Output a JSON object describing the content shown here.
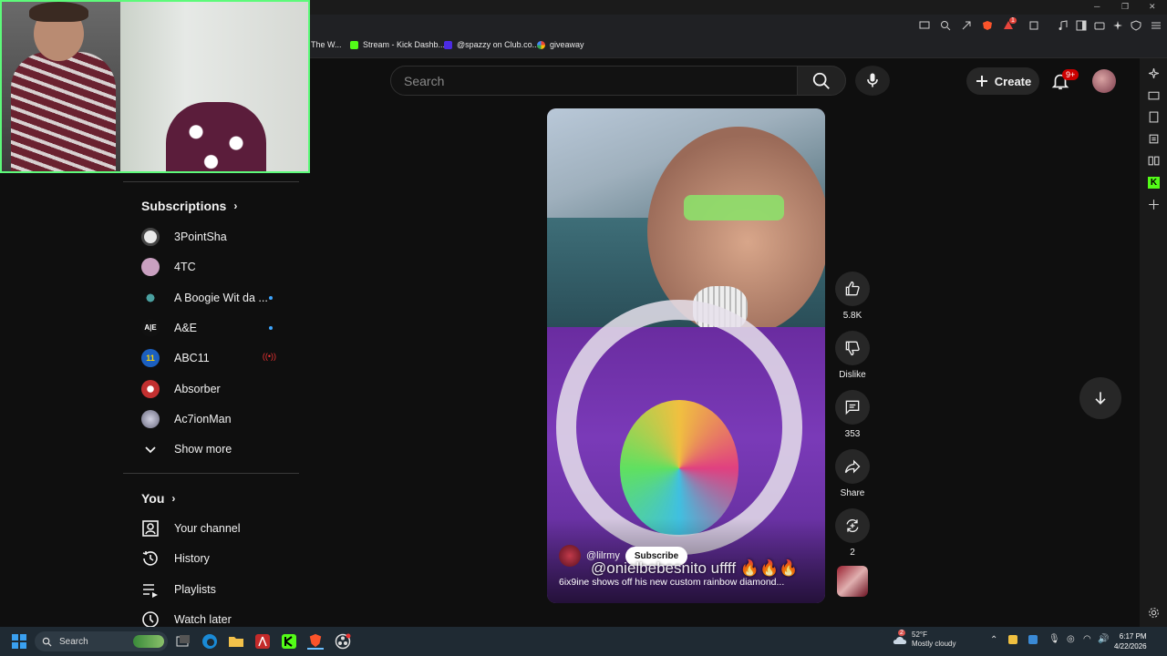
{
  "browser": {
    "bookmarks": [
      {
        "label": "The W...",
        "color": "#888888"
      },
      {
        "label": "Stream - Kick Dashb...",
        "color": "#53fc18"
      },
      {
        "label": "@spazzy on Club.co...",
        "color": "#4b2be3"
      },
      {
        "label": "giveaway",
        "color": "#e8a33d"
      }
    ],
    "shield_badge": "1"
  },
  "header": {
    "search_placeholder": "Search",
    "create_label": "Create",
    "notifications_badge": "9+"
  },
  "sidebar": {
    "subscriptions_heading": "Subscriptions",
    "subscriptions": [
      {
        "name": "3PointSha",
        "avatar_color": "#e8e8e8",
        "indicator": "none"
      },
      {
        "name": "4TC",
        "avatar_color": "#c9a0c0",
        "indicator": "none"
      },
      {
        "name": "A Boogie Wit da ...",
        "avatar_color": "#4aa0a0",
        "indicator": "new"
      },
      {
        "name": "A&E",
        "avatar_color": "#111111",
        "indicator": "new"
      },
      {
        "name": "ABC11",
        "avatar_color": "#1b5fbf",
        "indicator": "live"
      },
      {
        "name": "Absorber",
        "avatar_color": "#c23030",
        "indicator": "none"
      },
      {
        "name": "Ac7ionMan",
        "avatar_color": "#b0b0c0",
        "indicator": "none"
      }
    ],
    "show_more_label": "Show more",
    "you_heading": "You",
    "you_items": [
      {
        "label": "Your channel",
        "icon": "person-box-icon"
      },
      {
        "label": "History",
        "icon": "history-icon"
      },
      {
        "label": "Playlists",
        "icon": "playlists-icon"
      },
      {
        "label": "Watch later",
        "icon": "clock-icon"
      }
    ]
  },
  "short": {
    "channel_handle": "@lilrmy",
    "subscribe_label": "Subscribe",
    "overlay_caption": "@onielbebesnito uffff 🔥🔥🔥",
    "title": "6ix9ine shows off his new custom rainbow diamond...",
    "actions": {
      "like_count": "5.8K",
      "dislike_label": "Dislike",
      "comment_count": "353",
      "share_label": "Share",
      "remix_count": "2"
    }
  },
  "taskbar": {
    "search_label": "Search",
    "weather_badge": "2",
    "temperature": "52°F",
    "weather_desc": "Mostly cloudy",
    "time": "6:17 PM",
    "date": "4/22/2026"
  }
}
